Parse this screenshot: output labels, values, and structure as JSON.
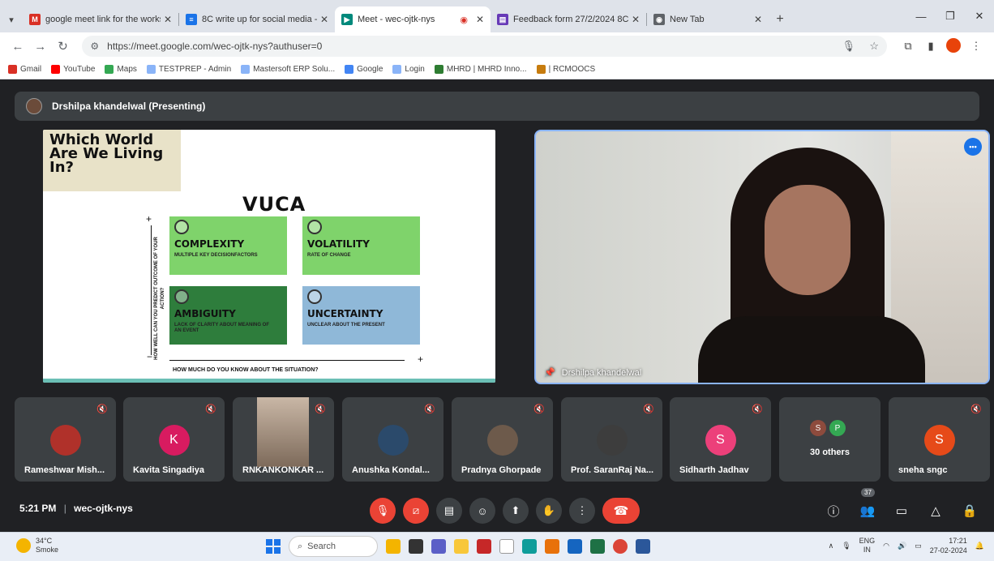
{
  "browser": {
    "tabs": [
      {
        "title": "google meet link for the works",
        "favicon": "gmail-icon",
        "color": "#d93025",
        "active": false
      },
      {
        "title": "8C write up for social media - G",
        "favicon": "docs-icon",
        "color": "#1a73e8",
        "active": false
      },
      {
        "title": "Meet - wec-ojtk-nys",
        "favicon": "meet-icon",
        "color": "#00897b",
        "active": true
      },
      {
        "title": "Feedback form 27/2/2024 8C",
        "favicon": "forms-icon",
        "color": "#673ab7",
        "active": false
      },
      {
        "title": "New Tab",
        "favicon": "chrome-icon",
        "color": "#5f6368",
        "active": false
      }
    ],
    "url": "https://meet.google.com/wec-ojtk-nys?authuser=0",
    "bookmarks": [
      {
        "label": "Gmail",
        "color": "#d93025"
      },
      {
        "label": "YouTube",
        "color": "#ff0000"
      },
      {
        "label": "Maps",
        "color": "#34a853"
      },
      {
        "label": "TESTPREP - Admin",
        "color": "#8ab4f8"
      },
      {
        "label": "Mastersoft ERP Solu...",
        "color": "#8ab4f8"
      },
      {
        "label": "Google",
        "color": "#4285f4"
      },
      {
        "label": "Login",
        "color": "#8ab4f8"
      },
      {
        "label": "MHRD | MHRD Inno...",
        "color": "#2e7d32"
      },
      {
        "label": "| RCMOOCS",
        "color": "#c77c0e"
      }
    ]
  },
  "meet": {
    "presenting_banner": "Drshilpa khandelwal (Presenting)",
    "slide": {
      "corner_title": "Which World Are We Living In?",
      "title": "VUCA",
      "quadrants": [
        {
          "title": "COMPLEXITY",
          "subtitle": "MULTIPLE KEY DECISIONFACTORS",
          "color": "#7fd36b"
        },
        {
          "title": "VOLATILITY",
          "subtitle": "RATE OF CHANGE",
          "color": "#7fd36b"
        },
        {
          "title": "AMBIGUITY",
          "subtitle": "LACK OF CLARITY ABOUT MEANING OF AN EVENT",
          "color": "#2e7d3c"
        },
        {
          "title": "UNCERTAINTY",
          "subtitle": "UNCLEAR ABOUT THE PRESENT",
          "color": "#8fb8d8"
        }
      ],
      "y_axis_label": "HOW WELL CAN YOU PREDICT OUTCOME OF YOUR ACTION?",
      "x_axis_label": "HOW MUCH DO YOU KNOW ABOUT THE SITUATION?",
      "plus": "+",
      "minus": "−"
    },
    "speaker_name": "Drshilpa khandelwal",
    "participants": [
      {
        "name": "Rameshwar Mish...",
        "initial": "",
        "color": "#b0312a"
      },
      {
        "name": "Kavita Singadiya",
        "initial": "K",
        "color": "#d81b60"
      },
      {
        "name": "RNKANKONKAR ...",
        "initial": "",
        "color": "#8d7a6a"
      },
      {
        "name": "Anushka Kondal...",
        "initial": "",
        "color": "#2b4a6b"
      },
      {
        "name": "Pradnya Ghorpade",
        "initial": "",
        "color": "#6d5a4b"
      },
      {
        "name": "Prof. SaranRaj Na...",
        "initial": "",
        "color": "#3d3d3d"
      },
      {
        "name": "Sidharth Jadhav",
        "initial": "S",
        "color": "#ec407a"
      },
      {
        "name": "sneha sngc",
        "initial": "S",
        "color": "#e64a19"
      }
    ],
    "others": {
      "label": "30 others",
      "avatar1": "S",
      "avatar2": "P",
      "color1": "#8d4b3d",
      "color2": "#34a853"
    },
    "time": "5:21 PM",
    "separator": "|",
    "meeting_code": "wec-ojtk-nys",
    "people_count": "37"
  },
  "taskbar": {
    "temp": "34°C",
    "condition": "Smoke",
    "search_placeholder": "Search",
    "lang": "ENG",
    "region": "IN",
    "time": "17:21",
    "date": "27-02-2024"
  }
}
